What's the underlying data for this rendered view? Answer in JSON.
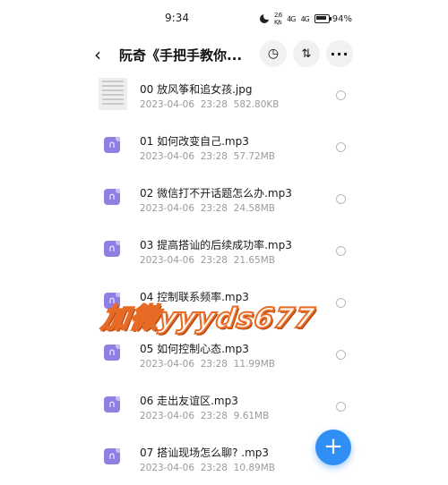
{
  "status_bar": {
    "time": "9:34",
    "network_speed": "2.6\nK/s",
    "signal_1": "4G",
    "signal_2": "4G",
    "battery": "94%"
  },
  "header": {
    "back_icon": "back-arrow-icon",
    "title": "阮奇《手把手教你...",
    "history_icon": "history-icon",
    "sort_icon": "sort-icon",
    "more_icon": "more-icon"
  },
  "files": [
    {
      "name": "00 放风筝和追女孩.jpg",
      "date": "2023-04-06",
      "time": "23:28",
      "size": "582.80KB",
      "kind": "image"
    },
    {
      "name": "01 如何改变自己.mp3",
      "date": "2023-04-06",
      "time": "23:28",
      "size": "57.72MB",
      "kind": "audio"
    },
    {
      "name": "02 微信打不开话题怎么办.mp3",
      "date": "2023-04-06",
      "time": "23:28",
      "size": "24.58MB",
      "kind": "audio"
    },
    {
      "name": "03 提高搭讪的后续成功率.mp3",
      "date": "2023-04-06",
      "time": "23:28",
      "size": "21.65MB",
      "kind": "audio"
    },
    {
      "name": "04 控制联系频率.mp3",
      "date": "",
      "time": "",
      "size": "",
      "kind": "audio"
    },
    {
      "name": "05 如何控制心态.mp3",
      "date": "2023-04-06",
      "time": "23:28",
      "size": "11.99MB",
      "kind": "audio"
    },
    {
      "name": "06 走出友谊区.mp3",
      "date": "2023-04-06",
      "time": "23:28",
      "size": "9.61MB",
      "kind": "audio"
    },
    {
      "name": "07 搭讪现场怎么聊? .mp3",
      "date": "2023-04-06",
      "time": "23:28",
      "size": "10.89MB",
      "kind": "audio"
    }
  ],
  "watermark": "加微yyyds677",
  "fab": {
    "label": "+",
    "icon": "plus-icon",
    "color": "#2f8ff5"
  },
  "colors": {
    "audio_icon": "#8f7fe3",
    "watermark_stroke": "#e76b24"
  }
}
